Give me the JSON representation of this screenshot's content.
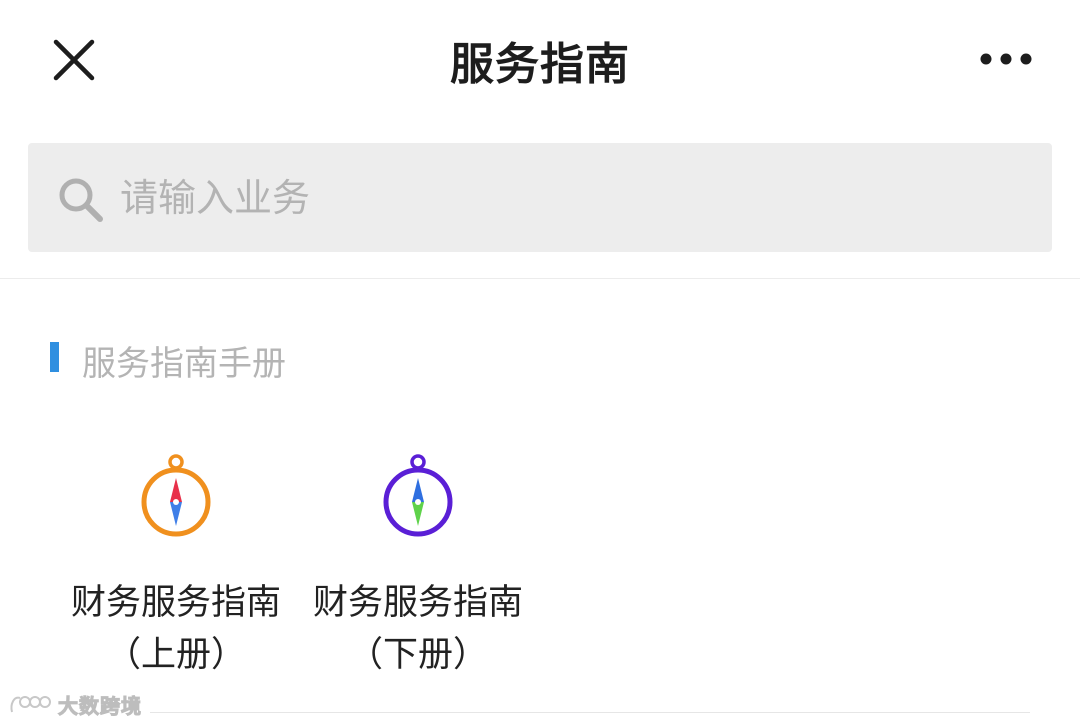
{
  "header": {
    "title": "服务指南",
    "close_icon": "close-icon",
    "more_icon": "more-dots-icon"
  },
  "search": {
    "placeholder": "请输入业务",
    "value": "",
    "icon": "search-icon"
  },
  "section": {
    "title": "服务指南手册",
    "accent_color": "#2f8fe0"
  },
  "guides": [
    {
      "title": "财务服务指南",
      "subtitle": "（上册）",
      "icon": "compass-icon",
      "ring_color": "#f0901e"
    },
    {
      "title": "财务服务指南",
      "subtitle": "（下册）",
      "icon": "compass-icon",
      "ring_color": "#5a1fd6"
    }
  ],
  "watermark": {
    "text": "大数跨境",
    "logo_text": "1000"
  }
}
